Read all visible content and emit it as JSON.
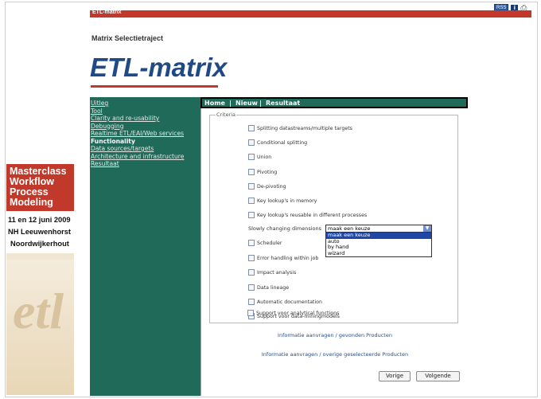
{
  "toolbar": {
    "rss_label": "RSS",
    "info_label": "i",
    "print_icon": "printer-icon"
  },
  "header": {
    "bar_title": "ETL-matrix",
    "subtitle": "Matrix Selectietraject",
    "logo_text": "ETL-matrix"
  },
  "sidebar": {
    "items": [
      {
        "label": "Uitleg",
        "active": false
      },
      {
        "label": "Tool",
        "active": false
      },
      {
        "label": "Clarity and re-usability",
        "active": false
      },
      {
        "label": "Debugging",
        "active": false
      },
      {
        "label": "Realtime ETL/EAI/Web services",
        "active": false
      },
      {
        "label": "Functionality",
        "active": true
      },
      {
        "label": "Data sources/targets",
        "active": false
      },
      {
        "label": "Architecture and infrastructure",
        "active": false
      },
      {
        "label": "Resultaat",
        "active": false
      }
    ]
  },
  "ad": {
    "line1": "Masterclass",
    "line2": "Workflow",
    "line3": "Process",
    "line4": "Modeling",
    "date1": "11 en 12 juni 2009",
    "date2": "NH Leeuwenhorst",
    "date3": "Noordwijkerhout",
    "logo_text": "etl"
  },
  "tabs": {
    "home": "Home",
    "sep1": "|",
    "nieuw": "Nieuw",
    "sep2": "|",
    "resultaat": "Resultaat"
  },
  "criteria": {
    "legend": "Criteria",
    "items": [
      "Splitting datastreams/multiple targets",
      "Conditional splitting",
      "Union",
      "Pivoting",
      "De-pivoting",
      "Key lookup's in memory",
      "Key lookup's reusable in different processes",
      "Scheduler",
      "Error handling within job",
      "Impact analysis",
      "Data lineage",
      "Automatic documentation",
      "Support voor data-miningmodels",
      "Support voor analytical functions"
    ]
  },
  "scd": {
    "label": "Slowly changing dimensions",
    "selected": "maak een keuze",
    "options": [
      "maak een keuze",
      "auto",
      "by hand",
      "wizard"
    ]
  },
  "links": {
    "link1": "Informatie aanvragen / gevonden Producten",
    "link2": "Informatie aanvragen / overige geselecteerde Producten"
  },
  "buttons": {
    "prev": "Vorige",
    "next": "Volgende"
  }
}
